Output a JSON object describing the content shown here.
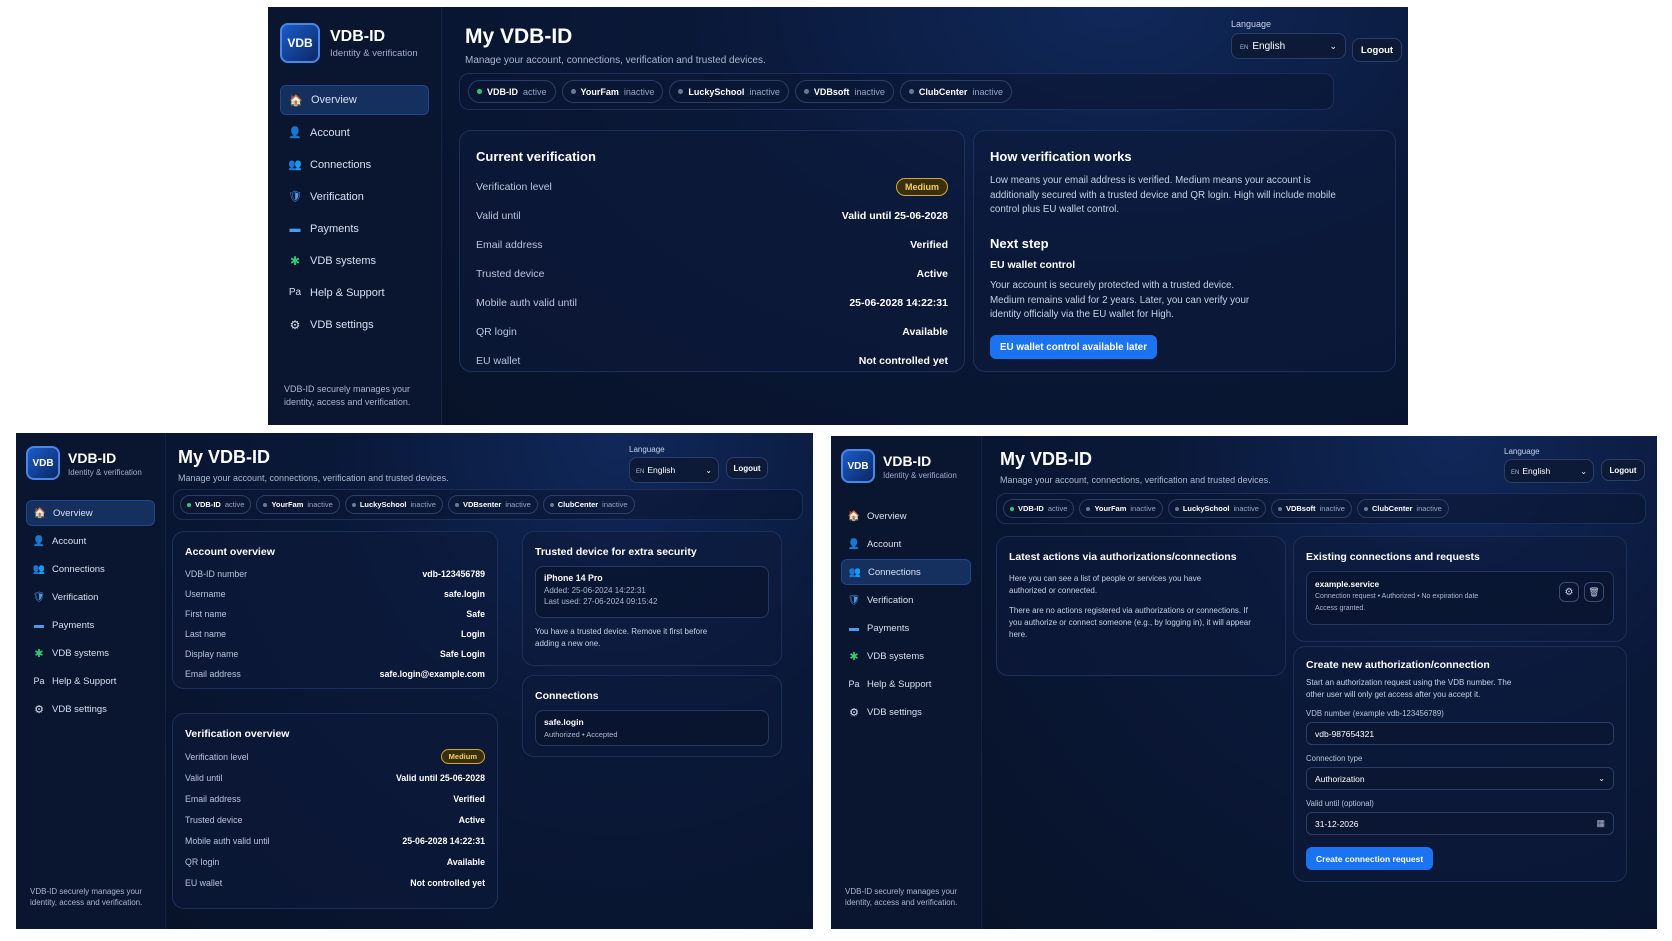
{
  "brand": {
    "logo": "VDB",
    "title": "VDB-ID",
    "subtitle": "Identity & verification"
  },
  "nav": [
    {
      "label": "Overview",
      "icon": "home-icon",
      "glyph": "🏠"
    },
    {
      "label": "Account",
      "icon": "user-icon",
      "glyph": "👤"
    },
    {
      "label": "Connections",
      "icon": "people-icon",
      "glyph": "👥"
    },
    {
      "label": "Verification",
      "icon": "shield-icon",
      "glyph": "🛡"
    },
    {
      "label": "Payments",
      "icon": "card-icon",
      "glyph": "▬"
    },
    {
      "label": "VDB systems",
      "icon": "puzzle-icon",
      "glyph": "✱"
    },
    {
      "label": "Help & Support",
      "icon": "help-icon",
      "glyph": "Pa"
    },
    {
      "label": "VDB settings",
      "icon": "gear-icon",
      "glyph": "⚙"
    }
  ],
  "sidebar_footer": "VDB-ID securely manages your identity, access and verification.",
  "header": {
    "title": "My VDB-ID",
    "subtitle": "Manage your account, connections, verification and trusted devices."
  },
  "language": {
    "label": "Language",
    "code": "EN",
    "value": "English"
  },
  "logout_label": "Logout",
  "systems": [
    {
      "name": "VDB-ID",
      "status": "active"
    },
    {
      "name": "YourFam",
      "status": "inactive"
    },
    {
      "name": "LuckySchool",
      "status": "inactive"
    },
    {
      "name": "VDBsoft",
      "status": "inactive"
    },
    {
      "name": "ClubCenter",
      "status": "inactive"
    }
  ],
  "systems_alt_name": "VDBsenter",
  "verification": {
    "title": "Current verification",
    "overview_title": "Verification overview",
    "rows": [
      {
        "label": "Verification level",
        "value": "Medium"
      },
      {
        "label": "Valid until",
        "value": "Valid until 25-06-2028"
      },
      {
        "label": "Email address",
        "value": "Verified"
      },
      {
        "label": "Trusted device",
        "value": "Active"
      },
      {
        "label": "Mobile auth valid until",
        "value": "25-06-2028 14:22:31"
      },
      {
        "label": "QR login",
        "value": "Available"
      },
      {
        "label": "EU wallet",
        "value": "Not controlled yet"
      }
    ]
  },
  "how": {
    "title": "How verification works",
    "text": "Low means your email address is verified. Medium means your account is additionally secured with a trusted device and QR login. High will include mobile control plus EU wallet control.",
    "next_title": "Next step",
    "next_sub": "EU wallet control",
    "next_text": "Your account is securely protected with a trusted device. Medium remains valid for 2 years. Later, you can verify your identity officially via the EU wallet for High.",
    "button": "EU wallet control available later"
  },
  "account": {
    "title": "Account overview",
    "rows": [
      {
        "label": "VDB-ID number",
        "value": "vdb-123456789"
      },
      {
        "label": "Username",
        "value": "safe.login"
      },
      {
        "label": "First name",
        "value": "Safe"
      },
      {
        "label": "Last name",
        "value": "Login"
      },
      {
        "label": "Display name",
        "value": "Safe Login"
      },
      {
        "label": "Email address",
        "value": "safe.login@example.com"
      }
    ]
  },
  "trusted": {
    "title": "Trusted device for extra security",
    "device": "iPhone 14 Pro",
    "added": "Added: 25-06-2024 14:22:31",
    "last_used": "Last used: 27-06-2024 09:15:42",
    "note": "You have a trusted device. Remove it first before adding a new one."
  },
  "connections_card": {
    "title": "Connections",
    "name": "safe.login",
    "status": "Authorized • Accepted"
  },
  "latest": {
    "title": "Latest actions via authorizations/connections",
    "text1": "Here you can see a list of people or services you have authorized or connected.",
    "text2": "There are no actions registered via authorizations or connections. If you authorize or connect someone (e.g., by logging in), it will appear here."
  },
  "existing": {
    "title": "Existing connections and requests",
    "name": "example.service",
    "meta": "Connection request • Authorized • No expiration date",
    "access": "Access granted."
  },
  "create": {
    "title": "Create new authorization/connection",
    "text": "Start an authorization request using the VDB number. The other user will only get access after you accept it.",
    "vdb_label": "VDB number (example vdb-123456789)",
    "vdb_value": "vdb-987654321",
    "type_label": "Connection type",
    "type_value": "Authorization",
    "valid_label": "Valid until (optional)",
    "valid_value": "31-12-2026",
    "button": "Create connection request"
  },
  "colors": {
    "accent": "#1a73f0",
    "background": "#081329",
    "active_dot": "#2ecc71",
    "badge": "#d4a82a"
  }
}
